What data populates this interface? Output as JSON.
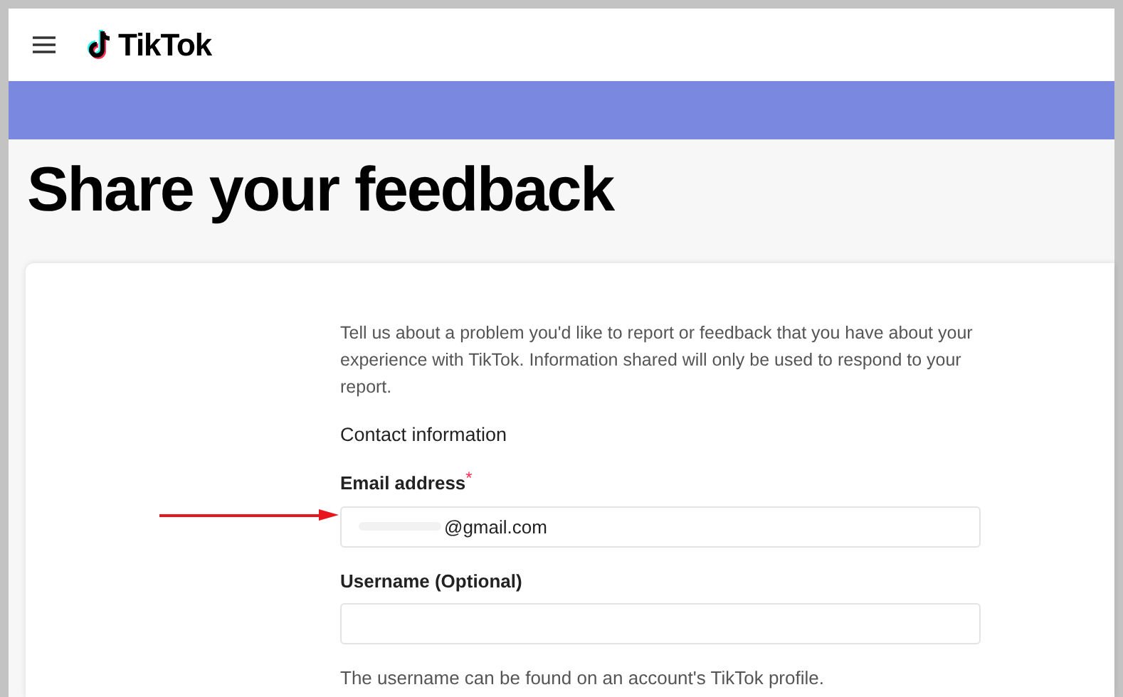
{
  "header": {
    "brand": "TikTok"
  },
  "page": {
    "title": "Share your feedback"
  },
  "form": {
    "intro": "Tell us about a problem you'd like to report or feedback that you have about your experience with TikTok. Information shared will only be used to respond to your report.",
    "section_title": "Contact information",
    "fields": [
      {
        "label": "Email address",
        "required": true,
        "value": "@gmail.com",
        "redacted": true,
        "annotated": true
      },
      {
        "label": "Username (Optional)",
        "required": false,
        "redacted": false,
        "annotated": false,
        "help": "The username can be found on an account's TikTok profile."
      }
    ],
    "required_mark": "*"
  }
}
